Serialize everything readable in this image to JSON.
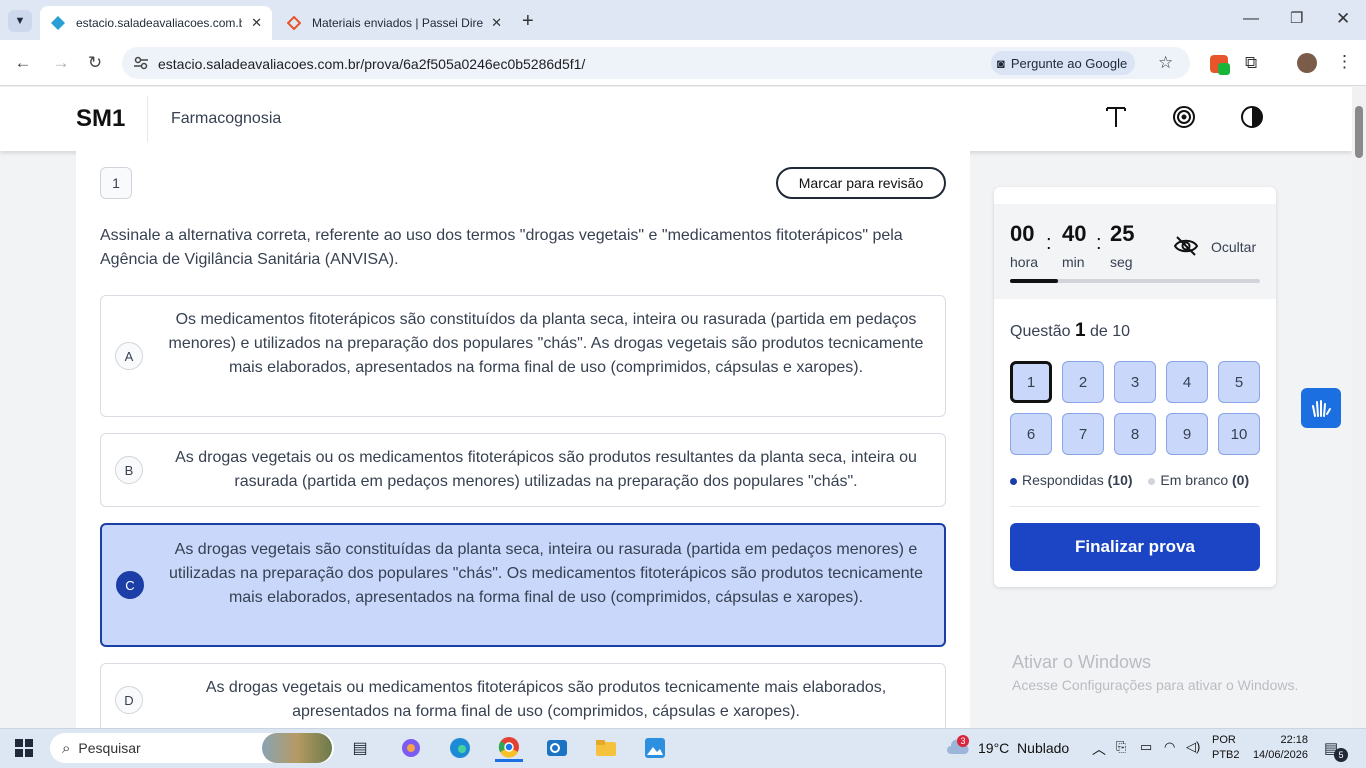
{
  "browser": {
    "tabs": [
      {
        "label": "estacio.saladeavaliacoes.com.br",
        "active": true
      },
      {
        "label": "Materiais enviados | Passei Dire",
        "active": false
      }
    ],
    "url": "estacio.saladeavaliacoes.com.br/prova/6a2f505a0246ec0b5286d5f1/",
    "google_button": "Pergunte ao Google"
  },
  "header": {
    "logo": "SM1",
    "course": "Farmacognosia"
  },
  "question": {
    "number": "1",
    "mark_review": "Marcar para revisão",
    "statement": "Assinale a alternativa correta, referente ao uso dos termos \"drogas vegetais\" e \"medicamentos fitoterápicos\" pela Agência de Vigilância Sanitária (ANVISA).",
    "options": [
      {
        "letter": "A",
        "text": "Os medicamentos fitoterápicos são constituídos da planta seca, inteira ou rasurada (partida em pedaços menores) e utilizados na preparação dos populares \"chás\". As drogas vegetais são produtos tecnicamente mais elaborados, apresentados na forma final de uso (comprimidos, cápsulas e xaropes).",
        "selected": false
      },
      {
        "letter": "B",
        "text": "As drogas vegetais ou os medicamentos fitoterápicos são produtos resultantes da planta seca, inteira ou rasurada (partida em pedaços menores) utilizadas na preparação dos populares \"chás\".",
        "selected": false
      },
      {
        "letter": "C",
        "text": "As drogas vegetais são constituídas da planta seca, inteira ou rasurada (partida em pedaços menores) e utilizadas na preparação dos populares \"chás\". Os medicamentos fitoterápicos são produtos tecnicamente mais elaborados, apresentados na forma final de uso (comprimidos, cápsulas e xaropes).",
        "selected": true
      },
      {
        "letter": "D",
        "text": "As drogas vegetais ou medicamentos fitoterápicos são produtos tecnicamente mais elaborados, apresentados na forma final de uso (comprimidos, cápsulas e xaropes).",
        "selected": false
      }
    ]
  },
  "timer": {
    "hours": "00",
    "hours_label": "hora",
    "minutes": "40",
    "minutes_label": "min",
    "seconds": "25",
    "seconds_label": "seg",
    "hide_label": "Ocultar",
    "progress": 0.19
  },
  "nav": {
    "prefix": "Questão",
    "current": "1",
    "suffix": "de 10",
    "questions": [
      "1",
      "2",
      "3",
      "4",
      "5",
      "6",
      "7",
      "8",
      "9",
      "10"
    ],
    "answered_label": "Respondidas",
    "answered_count": "(10)",
    "blank_label": "Em branco",
    "blank_count": "(0)",
    "finish": "Finalizar prova"
  },
  "watermark": {
    "title": "Ativar o Windows",
    "subtitle": "Acesse Configurações para ativar o Windows."
  },
  "taskbar": {
    "search": "Pesquisar",
    "weather": "19°C  Nublado",
    "weather_badge": "3",
    "lang1": "POR",
    "lang2": "PTB2",
    "time": "22:18",
    "date": "14/06/2026",
    "notif": "5"
  },
  "colors": {
    "accent": "#1b45c4",
    "selected_bg": "#c9d7fb"
  }
}
